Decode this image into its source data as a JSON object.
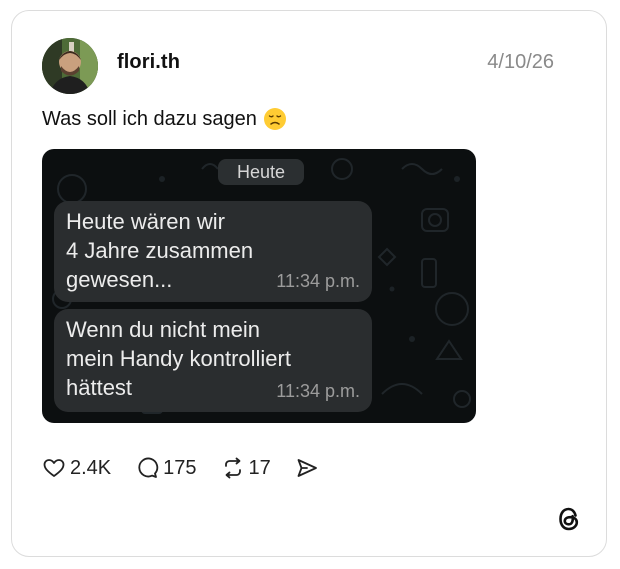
{
  "post": {
    "username": "flori.th",
    "date": "4/10/26",
    "caption": "Was soll ich dazu sagen",
    "caption_emoji": "disappointed-face"
  },
  "screenshot": {
    "day_label": "Heute",
    "messages": [
      {
        "text": "Heute wären wir\n4 Jahre zusammen\ngewesen...",
        "time": "11:34 p.m."
      },
      {
        "text": "Wenn du nicht mein\nmein Handy kontrolliert\nhättest",
        "time": "11:34 p.m."
      }
    ]
  },
  "actions": {
    "likes": "2.4K",
    "comments": "175",
    "reposts": "17"
  },
  "icons": [
    "heart-icon",
    "comment-icon",
    "repost-icon",
    "share-icon",
    "threads-logo-icon"
  ],
  "colors": {
    "chat_bg": "#0c0f10",
    "bubble": "#2a2d2f",
    "muted": "#8a8a8a"
  }
}
